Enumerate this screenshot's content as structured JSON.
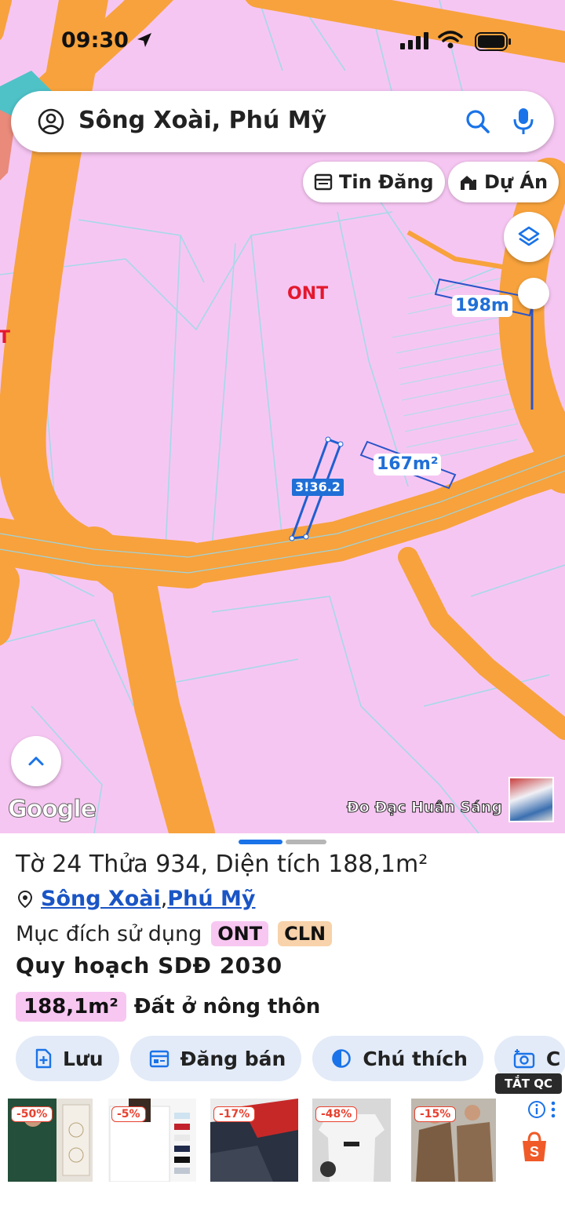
{
  "status_bar": {
    "time": "09:30"
  },
  "search": {
    "query": "Sông Xoài, Phú Mỹ"
  },
  "chips": {
    "listings": "Tin Đăng",
    "projects": "Dự Án"
  },
  "map": {
    "zone_label_main": "ONT",
    "zone_label_left": "T",
    "measure_198": "198m",
    "measure_167": "167m²",
    "width_label": "3!36.2",
    "google_logo": "Google",
    "watermark": "Đo Đạc Huân Sáng"
  },
  "parcel": {
    "title": "Tờ 24 Thửa 934, Diện tích 188,1m²",
    "commune": "Sông Xoài",
    "separator": ", ",
    "town": "Phú Mỹ",
    "purpose_label": "Mục đích sử dụng",
    "purpose_codes": [
      "ONT",
      "CLN"
    ],
    "plan_title": "Quy hoạch SDĐ 2030",
    "plan_area": "188,1m²",
    "plan_type": "Đất ở nông thôn"
  },
  "actions": [
    {
      "label": "Lưu",
      "icon": "add-note-icon"
    },
    {
      "label": "Đăng bán",
      "icon": "calendar-icon"
    },
    {
      "label": "Chú thích",
      "icon": "contrast-icon"
    },
    {
      "label": "C",
      "icon": "camera-icon"
    }
  ],
  "ads": {
    "close_label": "TẮT QC",
    "items": [
      {
        "discount": "-50%",
        "color": "#1f5a3d"
      },
      {
        "discount": "-5%",
        "color": "#f4f4f4"
      },
      {
        "discount": "-17%",
        "color": "#2b3340"
      },
      {
        "discount": "-48%",
        "color": "#eeeeee"
      },
      {
        "discount": "-15%",
        "color": "#8a6a4e"
      }
    ]
  },
  "colors": {
    "road": "#f7a23c",
    "zone": "#f6c6f2",
    "accent": "#1a73e8",
    "parcel_line": "#a7d8e8"
  }
}
